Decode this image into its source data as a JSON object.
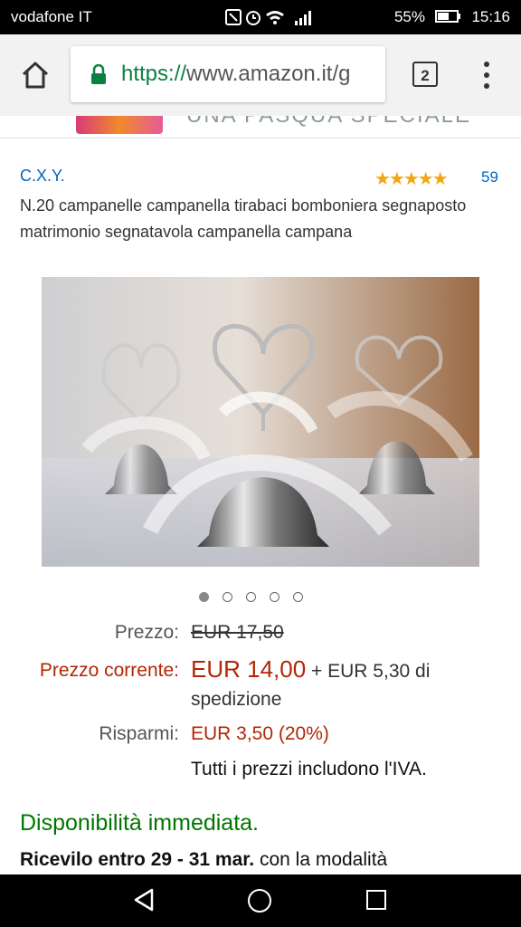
{
  "status_bar": {
    "carrier": "vodafone IT",
    "battery": "55%",
    "time": "15:16"
  },
  "browser": {
    "url_scheme": "https://",
    "url_rest": "www.amazon.it/g",
    "tab_count": "2"
  },
  "banner": {
    "text": "UNA PASQUA SPECIALE"
  },
  "product": {
    "brand": "C.X.Y.",
    "rating": 4.5,
    "stars": "★★★★★",
    "review_count": "59",
    "title": "N.20 campanelle campanella tirabaci bomboniera segnaposto matrimonio segnatavola campanella campana",
    "image_count": 5,
    "active_image": 1
  },
  "pricing": {
    "list_label": "Prezzo:",
    "list_price": "EUR 17,50",
    "current_label": "Prezzo corrente:",
    "current_price": "EUR 14,00",
    "shipping_line1": "+ EUR 5,30 di",
    "shipping_line2": "spedizione",
    "savings_label": "Risparmi:",
    "savings_value": "EUR 3,50 (20%)",
    "vat_note": "Tutti i prezzi includono l'IVA."
  },
  "availability": "Disponibilità immediata.",
  "delivery": {
    "bold": "Ricevilo entro 29 - 31 mar.",
    "rest": " con la modalità"
  },
  "colors": {
    "link": "#0066c0",
    "price": "#b12704",
    "in_stock": "#007600",
    "star": "#f3a614"
  }
}
